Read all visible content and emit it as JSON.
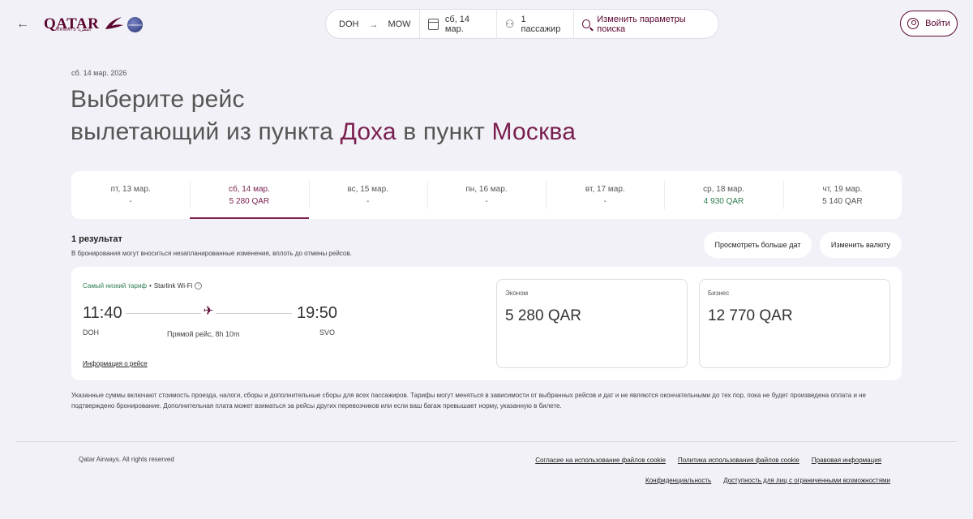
{
  "header": {
    "brand_name": "QATAR",
    "brand_sub": "AIRWAYS القطرية",
    "alliance_label": "oneworld",
    "search": {
      "origin": "DOH",
      "destination": "MOW",
      "date": "сб, 14 мар.",
      "passengers": "1 пассажир",
      "edit_label": "Изменить параметры поиска"
    },
    "login_label": "Войти"
  },
  "page": {
    "date_label": "сб. 14 мар. 2026",
    "title_line1": "Выберите рейс",
    "title_line2_prefix": "вылетающий из пункта ",
    "origin_city": "Доха",
    "title_line2_mid": " в пункт ",
    "destination_city": "Москва"
  },
  "date_strip": [
    {
      "day": "пт, 13 мар.",
      "price": "-",
      "state": "normal"
    },
    {
      "day": "сб, 14 мар.",
      "price": "5 280 QAR",
      "state": "active"
    },
    {
      "day": "вс, 15 мар.",
      "price": "-",
      "state": "normal"
    },
    {
      "day": "пн, 16 мар.",
      "price": "-",
      "state": "normal"
    },
    {
      "day": "вт, 17 мар.",
      "price": "-",
      "state": "normal"
    },
    {
      "day": "ср, 18 мар.",
      "price": "4 930 QAR",
      "state": "lowest"
    },
    {
      "day": "чт, 19 мар.",
      "price": "5 140 QAR",
      "state": "normal"
    }
  ],
  "results": {
    "count_label": "1 результат",
    "note": "В бронирования могут вноситься незапланированные изменения, вплоть до отмены рейсов.",
    "more_dates_label": "Просмотреть больше дат",
    "change_currency_label": "Изменить валюту"
  },
  "flight": {
    "tag_lowest": "Самый низкий тариф",
    "tag_separator": "•",
    "tag_wifi": "Starlink Wi-Fi",
    "info_glyph": "i",
    "plane_glyph": "✈",
    "departure_time": "11:40",
    "departure_code": "DOH",
    "arrival_time": "19:50",
    "arrival_code": "SVO",
    "duration": "Прямой рейс, 8h 10m",
    "info_link": "Информация о рейсе",
    "fares": {
      "economy_label": "Эконом",
      "economy_price": "5 280 QAR",
      "business_label": "Бизнес",
      "business_price": "12 770 QAR"
    }
  },
  "disclaimer": "Указанные суммы включают стоимость проезда, налоги, сборы и дополнительные сборы для всех пассажиров. Тарифы могут меняться в зависимости от выбранных рейсов и дат и не являются окончательными до тех пор, пока не будет произведена оплата и не подтверждено бронирование. Дополнительная плата может взиматься за рейсы других перевозчиков или если ваш багаж превышает норму, указанную в билете.",
  "footer": {
    "copyright": "Qatar Airways. All rights reserved",
    "links_row1": [
      "Согласие на использование файлов cookie",
      "Политика использования файлов cookie",
      "Правовая информация"
    ],
    "links_row2": [
      "Конфиденциальность",
      "Доступность для лиц с ограниченными возможностями"
    ]
  },
  "colors": {
    "brand": "#5c0632",
    "accent": "#7a1f4f",
    "lowest_price": "#2e7d4f",
    "background": "#f1f1f7"
  }
}
